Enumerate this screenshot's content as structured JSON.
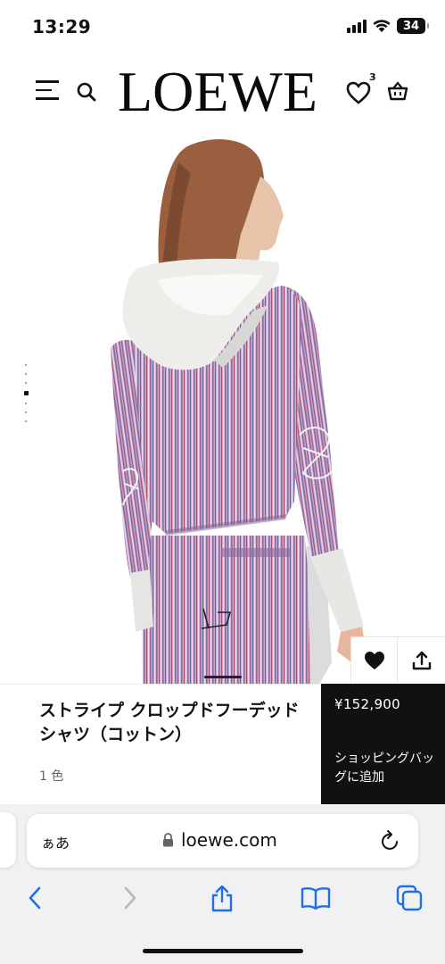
{
  "status_bar": {
    "time": "13:29",
    "battery": "34"
  },
  "header": {
    "logo": "LOEWE",
    "wishlist_count": "3"
  },
  "product": {
    "name": "ストライプ クロップドフーデッドシャツ（コットン）",
    "colors": "1 色",
    "price": "¥152,900",
    "add_to_bag": "ショッピングバッグに追加"
  },
  "browser": {
    "text_size_button": "ぁあ",
    "url": "loewe.com"
  },
  "colors": {
    "brand": "#111111",
    "stripe_purple": "#a98ab8",
    "stripe_red": "#b24a5c",
    "hood": "#ecece8"
  }
}
